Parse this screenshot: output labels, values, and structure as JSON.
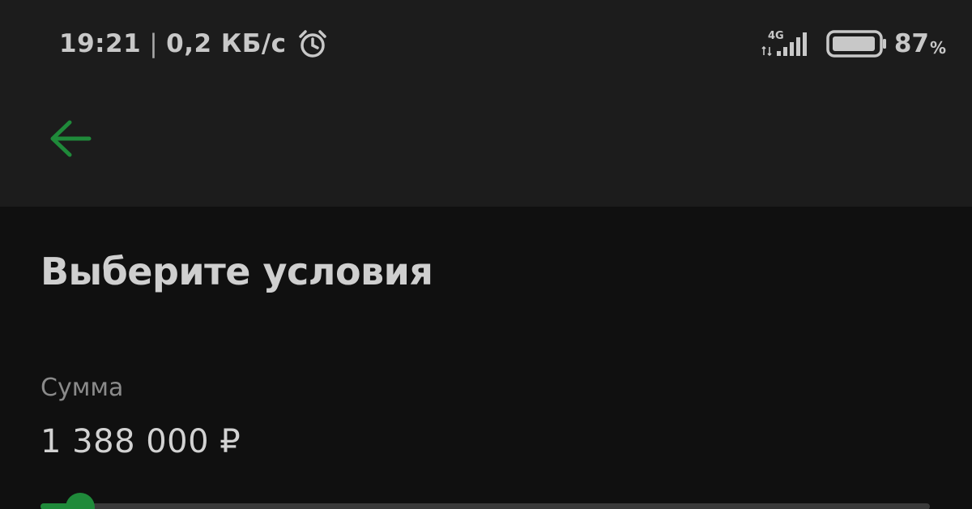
{
  "status_bar": {
    "time": "19:21",
    "separator": "|",
    "network_speed": "0,2 КБ/с",
    "network_type": "4G",
    "battery_level": "87",
    "battery_unit": "%",
    "icons": [
      "alarm-clock-icon",
      "mobile-data-icon",
      "signal-strength-icon",
      "battery-icon"
    ]
  },
  "header": {
    "back_icon": "arrow-left-icon"
  },
  "main": {
    "title": "Выберите условия",
    "amount": {
      "label": "Сумма",
      "value": "1 388 000 ₽",
      "slider_fraction": 0.045
    }
  },
  "colors": {
    "accent": "#1f8a3a",
    "background": "#101010",
    "header_background": "#1c1c1c",
    "text_primary": "#d2d2d2",
    "text_secondary": "#8a8a8a"
  }
}
